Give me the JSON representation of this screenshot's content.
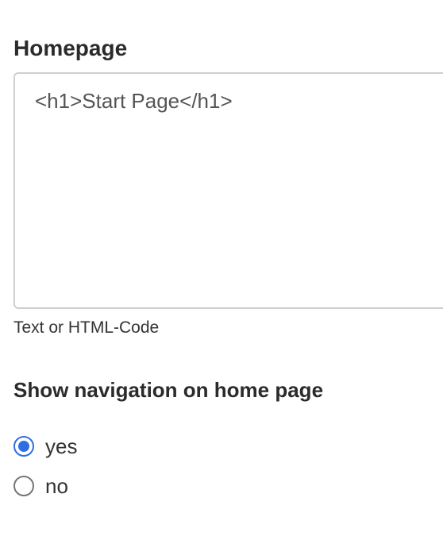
{
  "homepage": {
    "label": "Homepage",
    "value": "<h1>Start Page</h1>",
    "help": "Text or HTML-Code"
  },
  "navigation": {
    "label": "Show navigation on home page",
    "options": [
      {
        "label": "yes",
        "checked": true
      },
      {
        "label": "no",
        "checked": false
      }
    ]
  },
  "colors": {
    "accent": "#2f6fe0",
    "border": "#cfcfcf"
  }
}
